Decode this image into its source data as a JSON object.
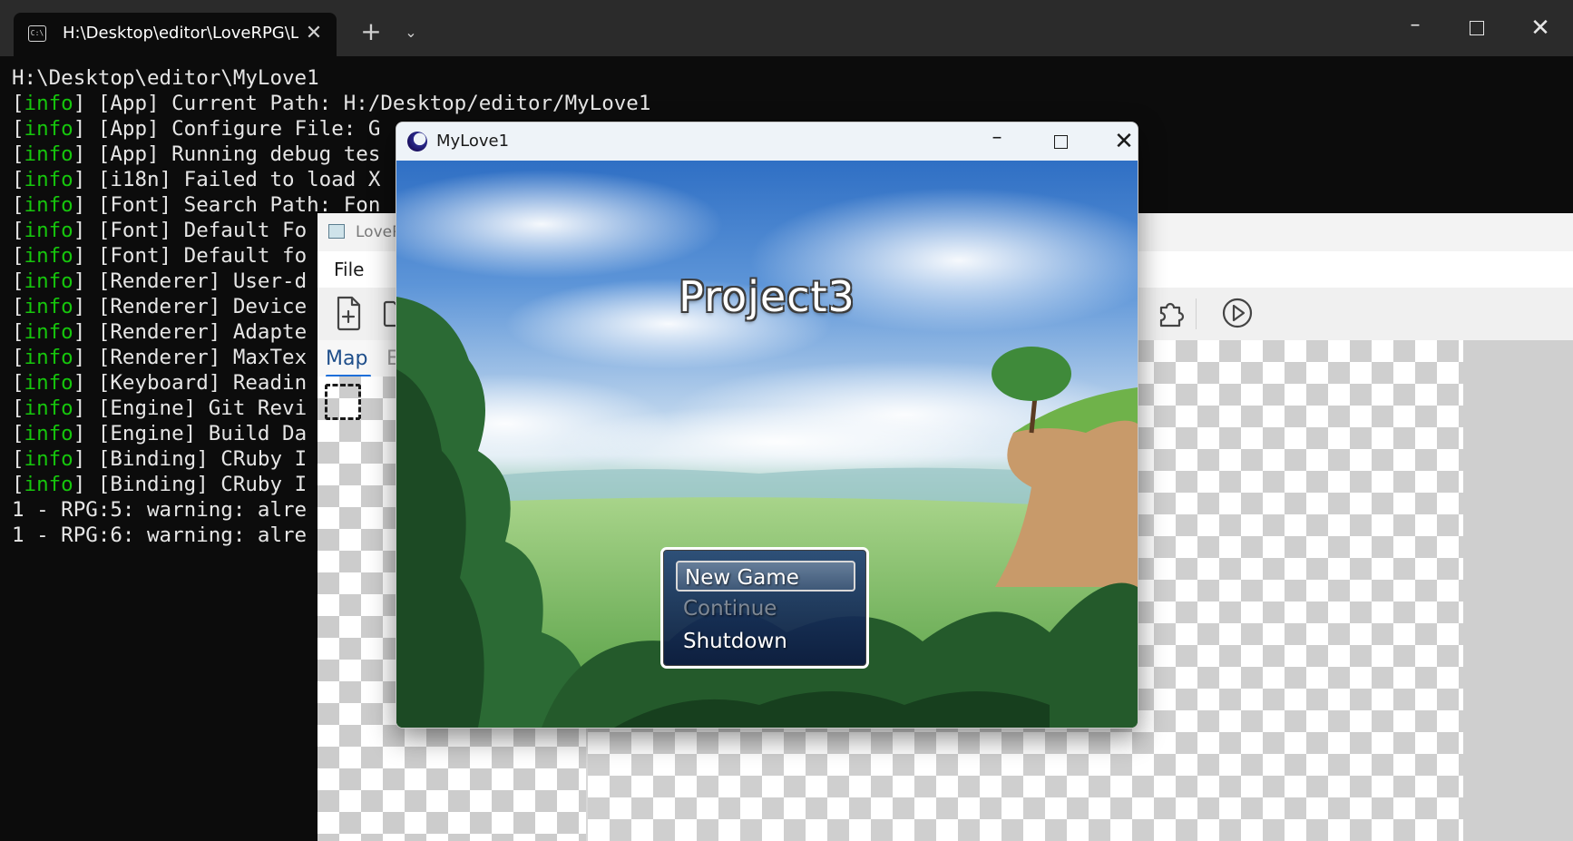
{
  "terminal": {
    "tab_title": "H:\\Desktop\\editor\\LoveRPG\\L",
    "tab_close": "✕",
    "new_tab": "+",
    "dropdown": "⌄",
    "minimize": "–",
    "close": "✕",
    "lines": [
      {
        "tag": "",
        "text": "H:\\Desktop\\editor\\MyLove1"
      },
      {
        "tag": "info",
        "text": " [App] Current Path: H:/Desktop/editor/MyLove1"
      },
      {
        "tag": "info",
        "text": " [App] Configure File: G"
      },
      {
        "tag": "info",
        "text": " [App] Running debug tes"
      },
      {
        "tag": "info",
        "text": " [i18n] Failed to load X"
      },
      {
        "tag": "info",
        "text": " [Font] Search Path: Fon"
      },
      {
        "tag": "info",
        "text": " [Font] Default Fo"
      },
      {
        "tag": "info",
        "text": " [Font] Default fo"
      },
      {
        "tag": "info",
        "text": " [Renderer] User-d"
      },
      {
        "tag": "info",
        "text": " [Renderer] Device"
      },
      {
        "tag": "info",
        "text": " [Renderer] Adapte"
      },
      {
        "tag": "info",
        "text": " [Renderer] MaxTex"
      },
      {
        "tag": "info",
        "text": " [Keyboard] Readin"
      },
      {
        "tag": "info",
        "text": " [Engine] Git Revi"
      },
      {
        "tag": "info",
        "text": " [Engine] Build Da"
      },
      {
        "tag": "info",
        "text": " [Binding] CRuby I"
      },
      {
        "tag": "info",
        "text": " [Binding] CRuby I"
      },
      {
        "tag": "",
        "text": "1 - RPG:5: warning: alre"
      },
      {
        "tag": "",
        "text": "1 - RPG:6: warning: alre"
      }
    ]
  },
  "editor": {
    "title": "LoveR",
    "menu_file": "File",
    "tab_map": "Map",
    "tab_partial": "E"
  },
  "game": {
    "window_title": "MyLove1",
    "minimize": "–",
    "close": "✕",
    "title_text": "Project3",
    "menu": {
      "new_game": "New Game",
      "continue": "Continue",
      "shutdown": "Shutdown"
    }
  },
  "colors": {
    "info_tag": "#16c60c",
    "terminal_bg": "#0c0c0c",
    "menu_window": "#1a3470"
  }
}
